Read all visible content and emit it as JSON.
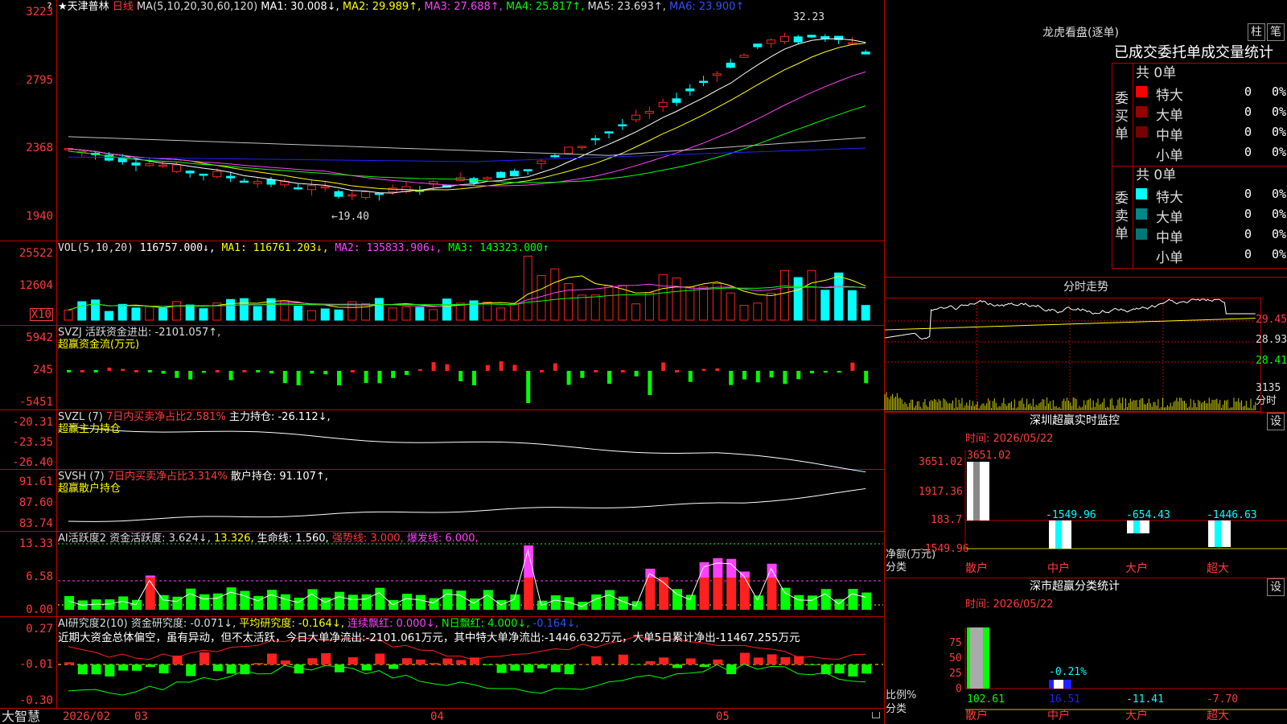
{
  "colors": {
    "up": "#ff2020",
    "down": "#00ffff",
    "grid": "#c00000",
    "ma1": "#ffffff",
    "ma2": "#ffff00",
    "ma3": "#ff40ff",
    "ma4": "#00ff00",
    "ma5": "#c0c0c0",
    "ma6": "#2020ff"
  },
  "header": {
    "star": "★",
    "name": "天津普林",
    "period": "日线",
    "ma_label": "MA(5,10,20,30,60,120)",
    "ma1": "MA1: 30.008↓,",
    "ma2": "MA2: 29.989↑,",
    "ma3": "MA3: 27.688↑,",
    "ma4": "MA4: 25.817↑,",
    "ma5": "MA5: 23.693↑,",
    "ma6": "MA6: 23.900↑",
    "high_mark": "32.23",
    "low_mark": "←19.40",
    "q": "?"
  },
  "price_axis": [
    "3223",
    "2795",
    "2368",
    "1940"
  ],
  "vol": {
    "label": "VOL(5,10,20)",
    "value": "116757.000↓,",
    "ma1": "MA1: 116761.203↓,",
    "ma2": "MA2: 135833.906↓,",
    "ma3": "MA3: 143323.000↑",
    "axis": [
      "25522",
      "12604"
    ],
    "x10": "X10"
  },
  "svzj": {
    "label": "SVZJ  活跃资金进出: -2101.057↑,",
    "sub": "超赢资金流(万元)",
    "axis": [
      "5942",
      "245",
      "-5451"
    ]
  },
  "svzl": {
    "label": "SVZL (7)",
    "pct": "7日内买卖净占比2.581%",
    "hold": "主力持仓: -26.112↓,",
    "sub": "超赢主力持仓",
    "axis": [
      "-20.31",
      "-23.35",
      "-26.40"
    ]
  },
  "svsh": {
    "label": "SVSH (7)",
    "pct": "7日内买卖净占比3.314%",
    "hold": "散户持仓: 91.107↑,",
    "sub": "超赢散户持仓",
    "axis": [
      "91.61",
      "87.60",
      "83.74"
    ]
  },
  "ai1": {
    "label": "AI活跃度2 资金活跃度: 3.624↓,",
    "v2": "13.326,",
    "life": "生命线: 1.560,",
    "strong": "强势线: 3.000,",
    "burst": "爆发线: 6.000,",
    "axis": [
      "13.33",
      "6.58",
      "0.00"
    ]
  },
  "ai2": {
    "label": "AI研究度2(10) 资金研究度: -0.071↓,",
    "avg": "平均研究度: -0.164↓,",
    "red": "连续飘红: 0.000↓,",
    "nred": "N日飘红: 4.000↓,",
    "last": "-0.164↓,",
    "note": "近期大资金总体偏空，虽有异动，但不太活跃，今日大单净流出:-2101.061万元，其中特大单净流出:-1446.632万元，大单5日累计净出-11467.255万元",
    "axis": [
      "0.27",
      "-0.01",
      "-0.30"
    ]
  },
  "xaxis": {
    "logo": "大智慧",
    "d1": "2026/02",
    "d2": "03",
    "d3": "04",
    "d4": "05"
  },
  "lhb": {
    "title": "龙虎看盘(逐单)",
    "btn1": "柱",
    "btn2": "笔",
    "tabs": "已成交委托单成交量统计",
    "buy_label": "委买单",
    "sell_label": "委卖单",
    "buy_total": "共 0单",
    "sell_total": "共 0单",
    "buy_rows": [
      {
        "name": "特大",
        "v": "0",
        "p": "0%",
        "c": "#ff0000"
      },
      {
        "name": "大单",
        "v": "0",
        "p": "0%",
        "c": "#990000"
      },
      {
        "name": "中单",
        "v": "0",
        "p": "0%",
        "c": "#770000"
      },
      {
        "name": "小单",
        "v": "0",
        "p": "0%",
        "c": ""
      }
    ],
    "sell_rows": [
      {
        "name": "特大",
        "v": "0",
        "p": "0%",
        "c": "#00ffff"
      },
      {
        "name": "大单",
        "v": "0",
        "p": "0%",
        "c": "#008888"
      },
      {
        "name": "中单",
        "v": "0",
        "p": "0%",
        "c": "#007777"
      },
      {
        "name": "小单",
        "v": "0",
        "p": "0%",
        "c": ""
      }
    ]
  },
  "fs": {
    "title": "分时走势",
    "axis": [
      "29.45",
      "28.93",
      "28.41"
    ],
    "vol_axis": [
      "3135",
      "分时"
    ]
  },
  "mon": {
    "title": "深圳超赢实时监控",
    "btn": "设",
    "time": "时间: 2026/05/22",
    "axis": [
      "3651.02",
      "1917.36",
      "183.7",
      "-1549.96"
    ],
    "vals": [
      "3651.02",
      "-1549.96",
      "-654.43",
      "-1446.63"
    ],
    "y1": "净额(万元)",
    "y2": "分类",
    "cats": [
      "散户",
      "中户",
      "大户",
      "超大"
    ]
  },
  "cls": {
    "title": "深市超赢分类统计",
    "btn": "设",
    "time": "时间: 2026/05/22",
    "axis": [
      "75",
      "50",
      "25",
      "0"
    ],
    "mid": "-0.21%",
    "vals": [
      "102.61",
      "16.51",
      "-11.41",
      "-7.70"
    ],
    "y1": "比例%",
    "y2": "分类",
    "cats": [
      "散户",
      "中户",
      "大户",
      "超大"
    ]
  }
}
